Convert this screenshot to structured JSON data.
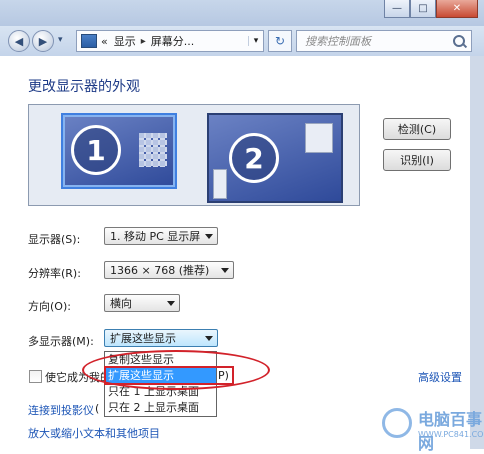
{
  "window": {
    "min_glyph": "—",
    "max_glyph": "□",
    "close_glyph": "✕"
  },
  "nav": {
    "back_glyph": "◀",
    "forward_glyph": "▶",
    "history_glyph": "▾",
    "breadcrumb": [
      "«",
      "显示",
      "▸",
      "屏幕分..."
    ],
    "address_dropdown_glyph": "▾",
    "refresh_glyph": "↻",
    "search_placeholder": "搜索控制面板"
  },
  "page": {
    "title": "更改显示器的外观"
  },
  "monitors": [
    {
      "label": "1",
      "selected": true
    },
    {
      "label": "2",
      "selected": false
    }
  ],
  "buttons": {
    "detect": "检测(C)",
    "identify": "识别(I)"
  },
  "settings": {
    "display_label": "显示器(S):",
    "display_value": "1. 移动 PC 显示屏",
    "resolution_label": "分辨率(R):",
    "resolution_value": "1366 × 768 (推荐)",
    "orientation_label": "方向(O):",
    "orientation_value": "横向",
    "multi_label": "多显示器(M):",
    "multi_value": "扩展这些显示"
  },
  "dropdown": {
    "options": [
      "复制这些显示",
      "扩展这些显示",
      "只在 1 上显示桌面",
      "只在 2 上显示桌面"
    ],
    "selected_index": 1
  },
  "checkbox_label": "使它成为我的",
  "checkbox_suffix": "P)",
  "advanced_link": "高级设置",
  "links": {
    "projector": "连接到投影仪",
    "projector_suffix": "(",
    "text_size": "放大或缩小文本和其他项目"
  },
  "watermark": {
    "name": "电脑百事网",
    "url": "WWW.PC841.COM"
  },
  "colors": {
    "accent": "#1e3b87",
    "link": "#1c55b6",
    "highlight": "#3399ff",
    "annotation_red": "#d2222a"
  }
}
